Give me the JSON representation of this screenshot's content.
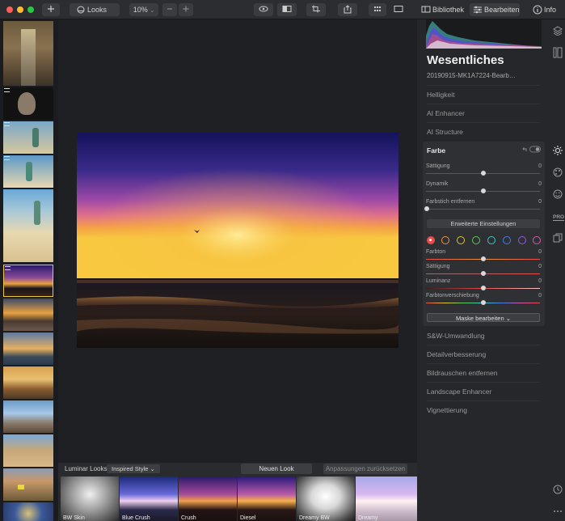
{
  "toolbar": {
    "looks_label": "Looks",
    "zoom_value": "10%",
    "zoom_arrow": "⌄",
    "tabs": {
      "library": "Bibliothek",
      "edit": "Bearbeiten",
      "info": "Info"
    }
  },
  "panel": {
    "title": "Wesentliches",
    "filename": "20190915-MK1A7224-Bearb…",
    "sections_top": [
      "Helligkeit",
      "AI Enhancer",
      "AI Structure"
    ],
    "farbe": {
      "title": "Farbe",
      "sliders": [
        {
          "label": "Sättigung",
          "value": "0"
        },
        {
          "label": "Dynamik",
          "value": "0"
        },
        {
          "label": "Farbstich entfernen",
          "value": "0"
        }
      ],
      "advanced_button": "Erweiterte Einstellungen",
      "color_dots": [
        "#e84c4c",
        "#e8963c",
        "#d8c83c",
        "#5cc85c",
        "#3cc8c8",
        "#4c7ce8",
        "#8c5ce8",
        "#d85ca8"
      ],
      "hsl_sliders": [
        {
          "label": "Farbton",
          "value": "0"
        },
        {
          "label": "Sättigung",
          "value": "0"
        },
        {
          "label": "Luminanz",
          "value": "0"
        },
        {
          "label": "Farbtonverschiebung",
          "value": "0"
        }
      ],
      "mask_button": "Maske bearbeiten ⌄"
    },
    "sections_bottom": [
      "S&W-Umwandlung",
      "Detailverbesserung",
      "Bildrauschen entfernen",
      "Landscape Enhancer",
      "Vignettierung"
    ]
  },
  "looksbar": {
    "label": "Luminar Looks:",
    "style_select": "Inspired Style ⌄",
    "save_button": "Neuen Look speichern…",
    "reset_button": "Anpassungen zurücksetzen",
    "looks": [
      "BW Skin",
      "Blue Crush",
      "Crush",
      "Diesel",
      "Dreamy BW",
      "Dreamy"
    ]
  },
  "rail": {
    "pro_label": "PRO"
  }
}
